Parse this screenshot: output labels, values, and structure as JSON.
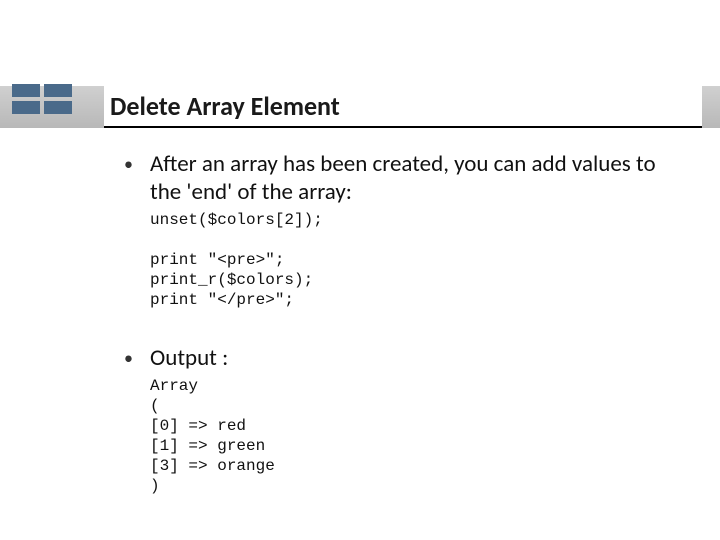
{
  "title": "Delete Array Element",
  "bullets": [
    {
      "text": "After an array has been created, you can add values to the 'end' of the array:",
      "code": "unset($colors[2]);\n\nprint \"<pre>\";\nprint_r($colors);\nprint \"</pre>\";"
    },
    {
      "text": "Output :",
      "code": "Array\n(\n[0] => red\n[1] => green\n[3] => orange\n)"
    }
  ]
}
